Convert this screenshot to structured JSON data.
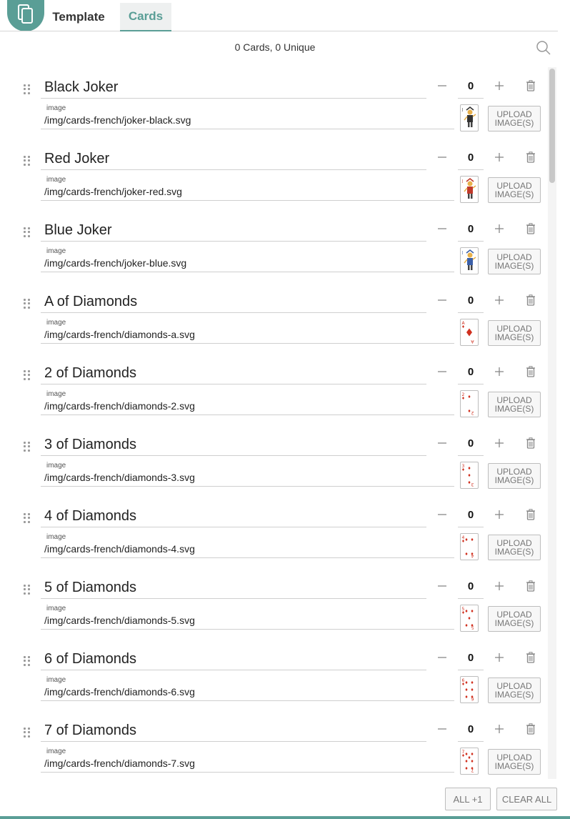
{
  "tabs": {
    "template_label": "Template",
    "cards_label": "Cards"
  },
  "summary": "0 Cards, 0 Unique",
  "image_field_label": "image",
  "upload_label": "UPLOAD\nIMAGE(S)",
  "cards": [
    {
      "name": "Black Joker",
      "count": "0",
      "image": "/img/cards-french/joker-black.svg",
      "thumb": "joker-black"
    },
    {
      "name": "Red Joker",
      "count": "0",
      "image": "/img/cards-french/joker-red.svg",
      "thumb": "joker-red"
    },
    {
      "name": "Blue Joker",
      "count": "0",
      "image": "/img/cards-french/joker-blue.svg",
      "thumb": "joker-blue"
    },
    {
      "name": "A of Diamonds",
      "count": "0",
      "image": "/img/cards-french/diamonds-a.svg",
      "thumb": "diamonds",
      "rank": "A",
      "pips": 1
    },
    {
      "name": "2 of Diamonds",
      "count": "0",
      "image": "/img/cards-french/diamonds-2.svg",
      "thumb": "diamonds",
      "rank": "2",
      "pips": 2
    },
    {
      "name": "3 of Diamonds",
      "count": "0",
      "image": "/img/cards-french/diamonds-3.svg",
      "thumb": "diamonds",
      "rank": "3",
      "pips": 3
    },
    {
      "name": "4 of Diamonds",
      "count": "0",
      "image": "/img/cards-french/diamonds-4.svg",
      "thumb": "diamonds",
      "rank": "4",
      "pips": 4
    },
    {
      "name": "5 of Diamonds",
      "count": "0",
      "image": "/img/cards-french/diamonds-5.svg",
      "thumb": "diamonds",
      "rank": "5",
      "pips": 5
    },
    {
      "name": "6 of Diamonds",
      "count": "0",
      "image": "/img/cards-french/diamonds-6.svg",
      "thumb": "diamonds",
      "rank": "6",
      "pips": 6
    },
    {
      "name": "7 of Diamonds",
      "count": "0",
      "image": "/img/cards-french/diamonds-7.svg",
      "thumb": "diamonds",
      "rank": "7",
      "pips": 7
    }
  ],
  "footer": {
    "all_plus_one": "ALL +1",
    "clear_all": "CLEAR ALL"
  },
  "colors": {
    "accent": "#5a9e96",
    "diamond_red": "#d0301f"
  }
}
